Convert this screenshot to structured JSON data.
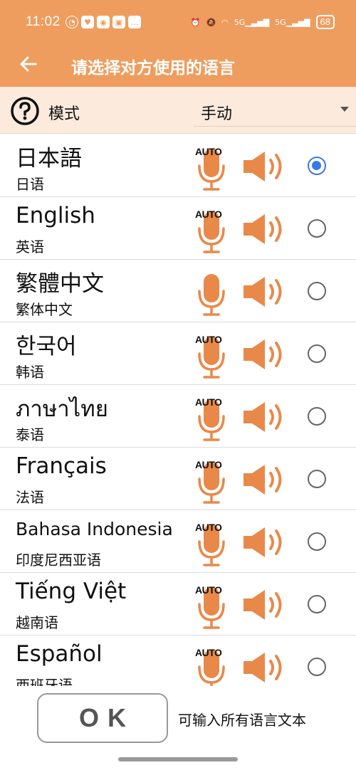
{
  "status_bar": {
    "time": "11:02",
    "battery": "68",
    "network_1": "5G",
    "network_2": "5G"
  },
  "app_bar": {
    "title": "请选择对方使用的语言"
  },
  "mode": {
    "label": "模式",
    "value": "手动"
  },
  "languages": [
    {
      "name": "日本語",
      "sub": "日语",
      "auto": "AUTO",
      "selected": true
    },
    {
      "name": "English",
      "sub": "英语",
      "auto": "AUTO",
      "selected": false
    },
    {
      "name": "繁體中文",
      "sub": "繁体中文",
      "auto": "",
      "selected": false
    },
    {
      "name": "한국어",
      "sub": "韩语",
      "auto": "AUTO",
      "selected": false
    },
    {
      "name": "ภาษาไทย",
      "sub": "泰语",
      "auto": "AUTO",
      "selected": false
    },
    {
      "name": "Français",
      "sub": "法语",
      "auto": "AUTO",
      "selected": false
    },
    {
      "name": "Bahasa Indonesia",
      "sub": "印度尼西亚语",
      "auto": "AUTO",
      "selected": false
    },
    {
      "name": "Tiếng Việt",
      "sub": "越南语",
      "auto": "AUTO",
      "selected": false
    },
    {
      "name": "Español",
      "sub": "西班牙语",
      "auto": "AUTO",
      "selected": false
    }
  ],
  "footer": {
    "ok_label": "OK",
    "hint": "可输入所有语言文本"
  },
  "colors": {
    "accent": "#EE9D5E",
    "icon_orange": "#E8894A",
    "mode_bg": "#FCEBDD",
    "radio_selected": "#3B78E7"
  }
}
